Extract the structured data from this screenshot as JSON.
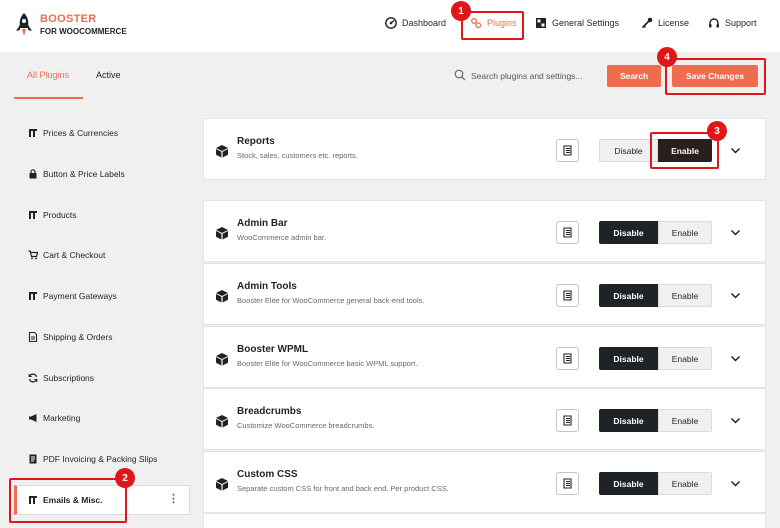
{
  "app": {
    "logo_line1": "BOOSTER",
    "logo_line2": "FOR WOOCOMMERCE"
  },
  "nav": [
    {
      "label": "Dashboard",
      "icon": "dashboard-icon"
    },
    {
      "label": "Plugins",
      "icon": "plugins-icon",
      "active": true
    },
    {
      "label": "General Settings",
      "icon": "settings-grid-icon"
    },
    {
      "label": "License",
      "icon": "key-icon"
    },
    {
      "label": "Support",
      "icon": "headset-icon"
    }
  ],
  "tabs": [
    {
      "label": "All Plugins",
      "active": true
    },
    {
      "label": "Active"
    }
  ],
  "search": {
    "placeholder": "Search plugins and settings...",
    "button": "Search"
  },
  "save_button": "Save Changes",
  "sidebar": {
    "items": [
      {
        "label": "Prices & Currencies"
      },
      {
        "label": "Button & Price Labels"
      },
      {
        "label": "Products"
      },
      {
        "label": "Cart & Checkout"
      },
      {
        "label": "Payment Gateways"
      },
      {
        "label": "Shipping & Orders"
      },
      {
        "label": "Subscriptions"
      },
      {
        "label": "Marketing"
      },
      {
        "label": "PDF Invoicing & Packing Slips"
      },
      {
        "label": "Emails & Misc.",
        "active": true
      }
    ],
    "more_glyph": "⋮"
  },
  "modules": [
    {
      "title": "Reports",
      "desc": "Stock, sales, customers etc. reports.",
      "state": "enabled"
    },
    {
      "title": "Admin Bar",
      "desc": "WooCommerce admin bar.",
      "state": "disabled"
    },
    {
      "title": "Admin Tools",
      "desc": "Booster Elite for WooCommerce general back-end tools.",
      "state": "disabled"
    },
    {
      "title": "Booster WPML",
      "desc": "Booster Elite for WooCommerce basic WPML support.",
      "state": "disabled"
    },
    {
      "title": "Breadcrumbs",
      "desc": "Customize WooCommerce breadcrumbs.",
      "state": "disabled"
    },
    {
      "title": "Custom CSS",
      "desc": "Separate custom CSS for front and back end. Per product CSS.",
      "state": "disabled"
    }
  ],
  "toggle": {
    "disable_label": "Disable",
    "enable_label": "Enable"
  },
  "callouts": [
    "1",
    "2",
    "3",
    "4"
  ],
  "colors": {
    "accent": "#ef6c4f",
    "dark": "#1d2327",
    "callout": "#e0161a"
  }
}
